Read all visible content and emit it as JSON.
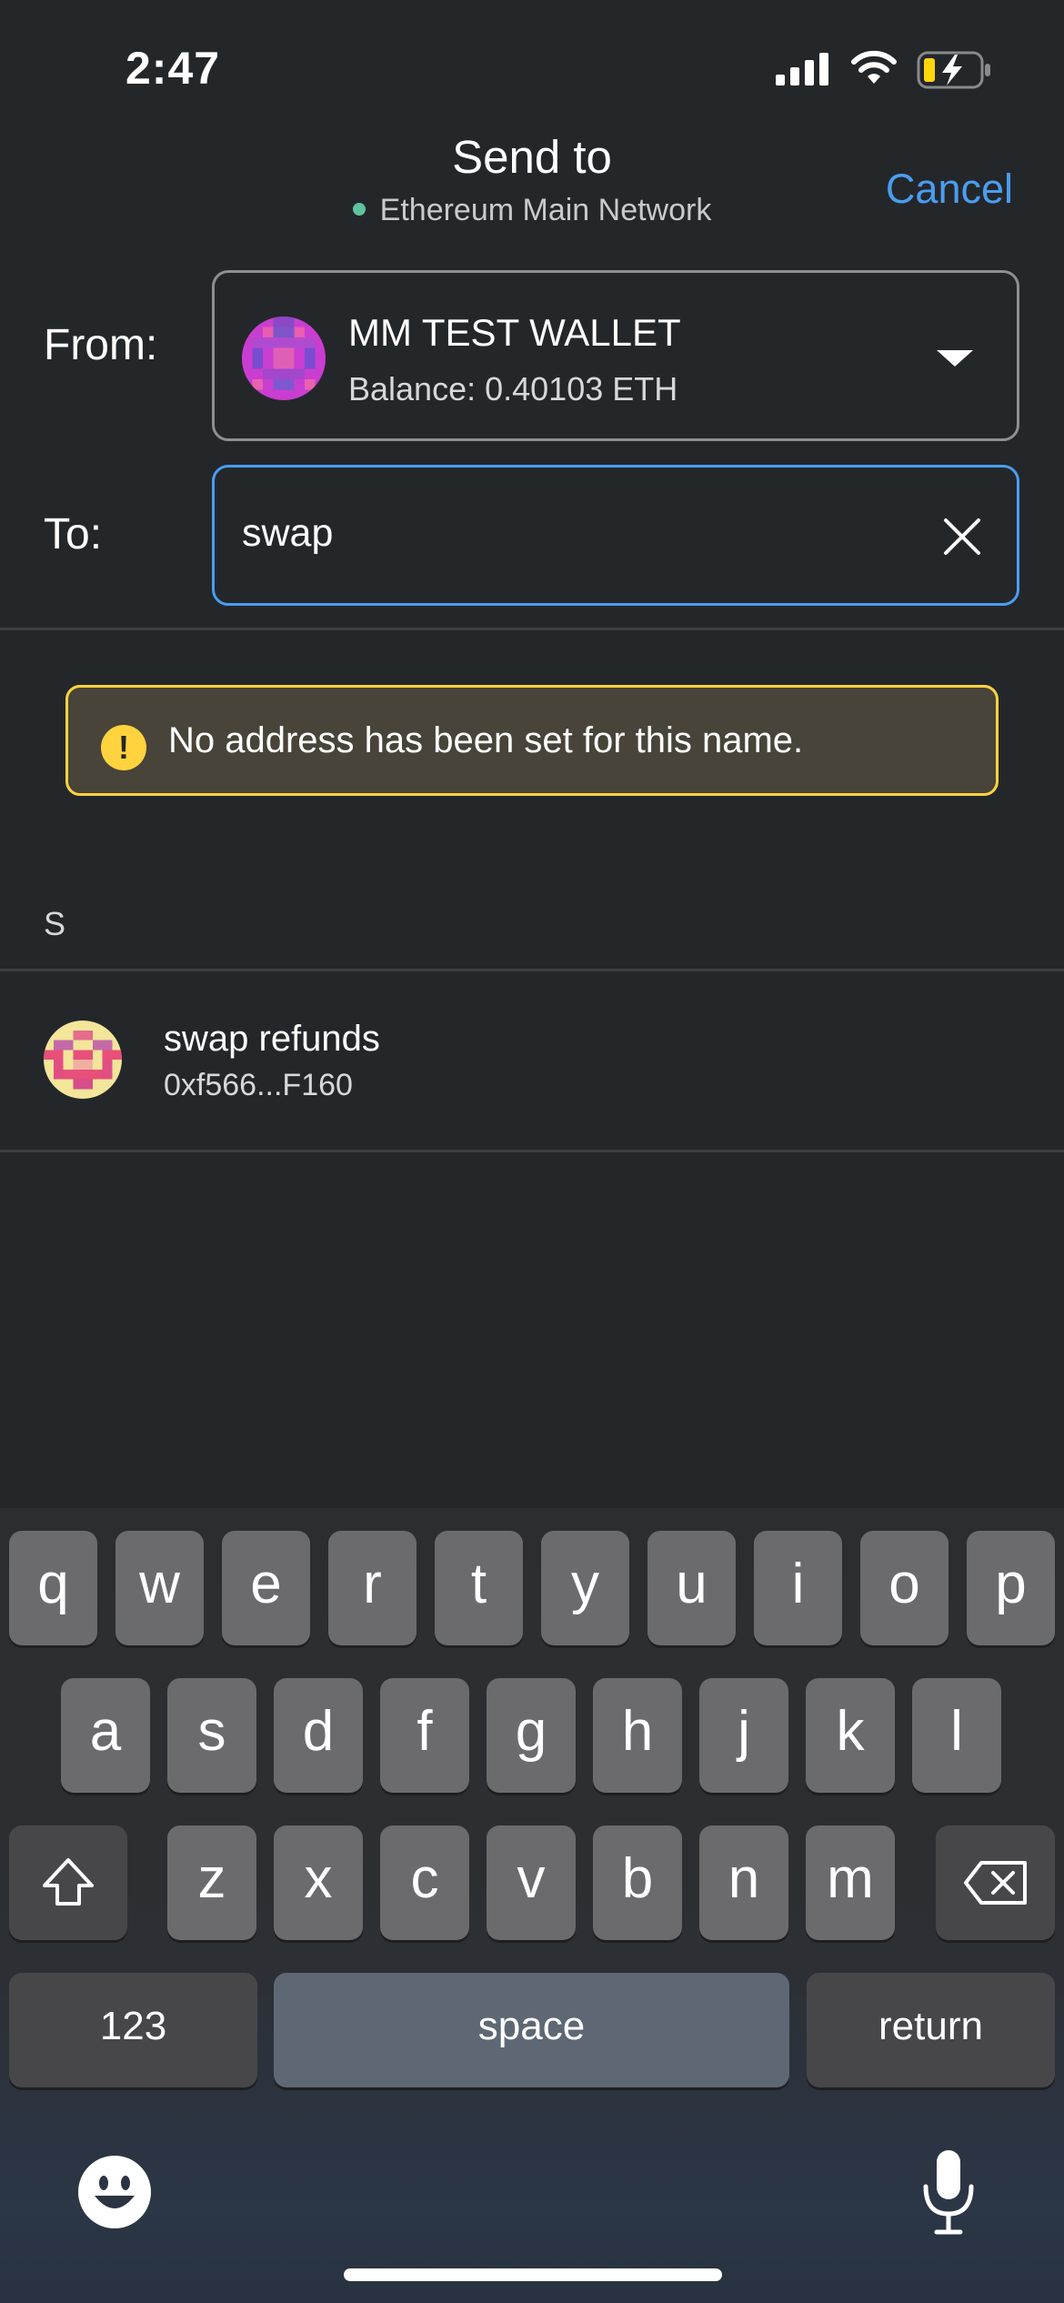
{
  "status_bar": {
    "time": "2:47"
  },
  "header": {
    "title": "Send to",
    "network": "Ethereum Main Network",
    "cancel_label": "Cancel"
  },
  "from": {
    "label": "From:",
    "wallet_name": "MM TEST WALLET",
    "balance": "Balance: 0.40103 ETH"
  },
  "to": {
    "label": "To:",
    "value": "swap"
  },
  "warning": {
    "icon": "!",
    "text": "No address has been set for this name."
  },
  "contacts": {
    "section_letter": "S",
    "items": [
      {
        "name": "swap refunds",
        "address": "0xf566...F160"
      }
    ]
  },
  "keyboard": {
    "row1": [
      "q",
      "w",
      "e",
      "r",
      "t",
      "y",
      "u",
      "i",
      "o",
      "p"
    ],
    "row2": [
      "a",
      "s",
      "d",
      "f",
      "g",
      "h",
      "j",
      "k",
      "l"
    ],
    "row3": [
      "z",
      "x",
      "c",
      "v",
      "b",
      "n",
      "m"
    ],
    "numbers_label": "123",
    "space_label": "space",
    "return_label": "return"
  },
  "colors": {
    "background": "#24272a",
    "accent": "#4a9df1",
    "warning": "#ffd33d",
    "network_dot": "#5fc49e"
  },
  "icons": [
    "signal-icon",
    "wifi-icon",
    "battery-charging-icon",
    "caret-down-icon",
    "clear-icon",
    "warning-icon",
    "shift-icon",
    "backspace-icon",
    "emoji-icon",
    "microphone-icon"
  ]
}
